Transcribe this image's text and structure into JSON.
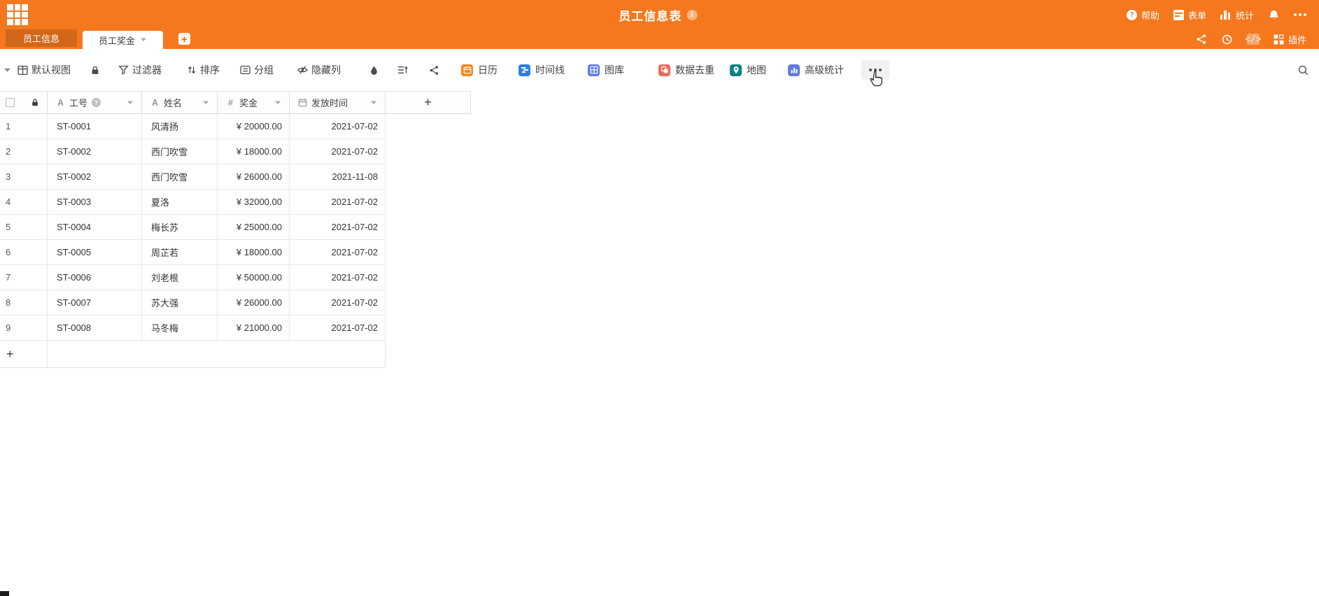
{
  "app": {
    "title": "员工信息表",
    "topbar": {
      "help": "帮助",
      "form": "表单",
      "stats": "统计"
    },
    "colors": {
      "brand_orange": "#F5781E",
      "tab_inactive_overlay": "rgba(0,0,0,0.14)"
    }
  },
  "tabs": {
    "items": [
      {
        "label": "员工信息",
        "active": false
      },
      {
        "label": "员工奖金",
        "active": true
      }
    ],
    "plugins_label": "插件"
  },
  "toolbar": {
    "view_name": "默认视图",
    "filter_label": "过滤器",
    "sort_label": "排序",
    "group_label": "分组",
    "hide_label": "隐藏列",
    "apps": [
      {
        "label": "日历",
        "color": "#F5861C"
      },
      {
        "label": "时间线",
        "color": "#2E7FE0"
      },
      {
        "label": "图库",
        "color": "#5E7CE2"
      },
      {
        "label": "数据去重",
        "color": "#E96A5C"
      },
      {
        "label": "地图",
        "color": "#0E8384"
      },
      {
        "label": "高级统计",
        "color": "#5E7CE2"
      }
    ]
  },
  "table": {
    "columns": [
      {
        "label": "工号",
        "type": "text"
      },
      {
        "label": "姓名",
        "type": "text"
      },
      {
        "label": "奖金",
        "type": "number"
      },
      {
        "label": "发放时间",
        "type": "date"
      }
    ],
    "rows": [
      {
        "num": "1",
        "id": "ST-0001",
        "name": "风清扬",
        "bonus": "¥ 20000.00",
        "date": "2021-07-02"
      },
      {
        "num": "2",
        "id": "ST-0002",
        "name": "西门吹雪",
        "bonus": "¥ 18000.00",
        "date": "2021-07-02"
      },
      {
        "num": "3",
        "id": "ST-0002",
        "name": "西门吹雪",
        "bonus": "¥ 26000.00",
        "date": "2021-11-08"
      },
      {
        "num": "4",
        "id": "ST-0003",
        "name": "夏洛",
        "bonus": "¥ 32000.00",
        "date": "2021-07-02"
      },
      {
        "num": "5",
        "id": "ST-0004",
        "name": "梅长苏",
        "bonus": "¥ 25000.00",
        "date": "2021-07-02"
      },
      {
        "num": "6",
        "id": "ST-0005",
        "name": "周芷若",
        "bonus": "¥ 18000.00",
        "date": "2021-07-02"
      },
      {
        "num": "7",
        "id": "ST-0006",
        "name": "刘老根",
        "bonus": "¥ 50000.00",
        "date": "2021-07-02"
      },
      {
        "num": "8",
        "id": "ST-0007",
        "name": "苏大强",
        "bonus": "¥ 26000.00",
        "date": "2021-07-02"
      },
      {
        "num": "9",
        "id": "ST-0008",
        "name": "马冬梅",
        "bonus": "¥ 21000.00",
        "date": "2021-07-02"
      }
    ]
  }
}
